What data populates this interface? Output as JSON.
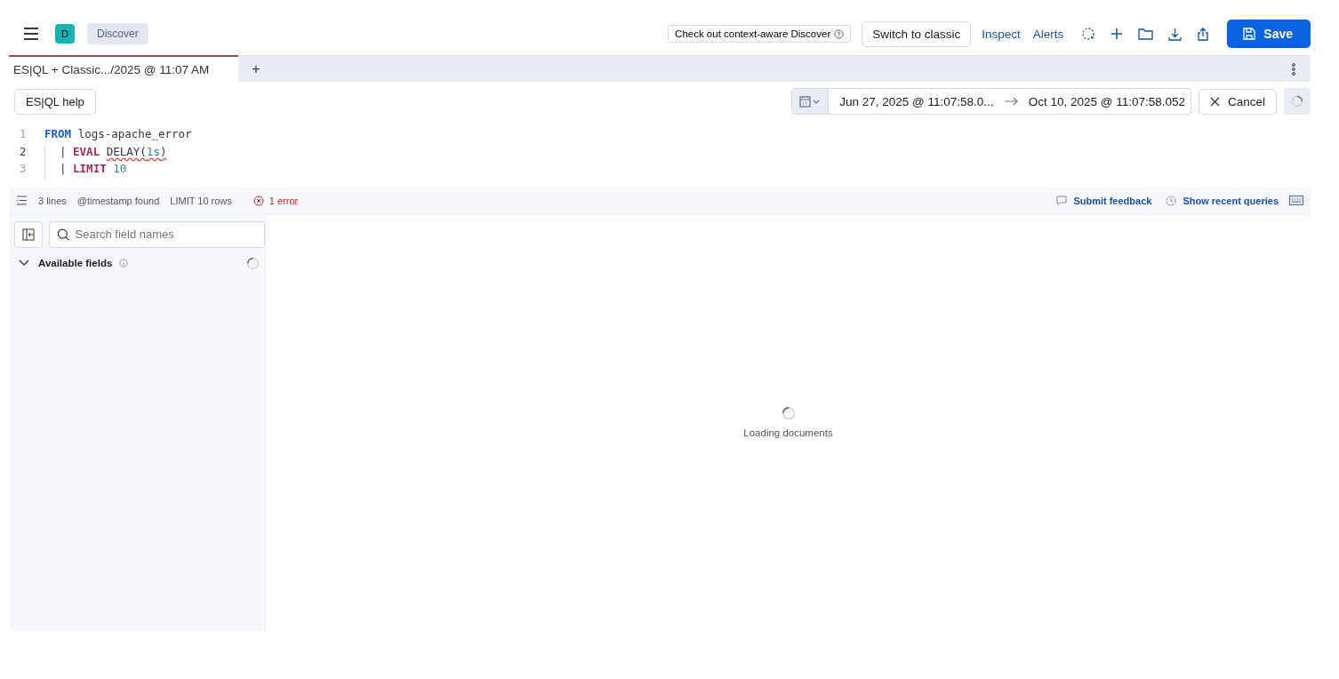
{
  "header": {
    "avatar": "D",
    "breadcrumb": "Discover",
    "actions": [
      {
        "kind": "promo",
        "label": "Check out context-aware Discover"
      },
      {
        "kind": "button",
        "label": "Switch to classic"
      },
      {
        "kind": "link",
        "label": "Inspect"
      },
      {
        "kind": "link",
        "label": "Alerts"
      },
      {
        "kind": "primary",
        "label": "Save"
      }
    ]
  },
  "tabs": [
    {
      "label": "ES|QL + Classic.../2025 @ 11:07 AM",
      "selected": true
    }
  ],
  "new_tab": "+",
  "query_bar": {
    "help_button": "ES|QL help",
    "date_start": "Jun 27, 2025 @ 11:07:58.0...",
    "date_end": "Oct 10, 2025 @ 11:07:58.052",
    "cancel": "Cancel"
  },
  "editor": {
    "lines": [
      {
        "number": "1",
        "current": false,
        "tokens": [
          {
            "text": "FROM ",
            "kind": "command",
            "error": false
          },
          {
            "text": "logs-apache_error",
            "kind": "plain",
            "error": false
          }
        ]
      },
      {
        "number": "2",
        "current": true,
        "tokens": [
          {
            "text": "| ",
            "kind": "pipe",
            "error": false
          },
          {
            "text": "EVAL ",
            "kind": "keyword",
            "error": false
          },
          {
            "text": "DELAY(",
            "kind": "plain",
            "error": true
          },
          {
            "text": "1s",
            "kind": "number",
            "error": true
          },
          {
            "text": ")",
            "kind": "plain",
            "error": true
          }
        ]
      },
      {
        "number": "3",
        "current": false,
        "tokens": [
          {
            "text": "| ",
            "kind": "pipe",
            "error": false
          },
          {
            "text": "LIMIT ",
            "kind": "keyword",
            "error": false
          },
          {
            "text": "10",
            "kind": "number",
            "error": false
          }
        ]
      }
    ]
  },
  "editor_footer": {
    "items": [
      "3 lines",
      "@timestamp found",
      "LIMIT 10 rows"
    ],
    "errors": "1 error",
    "feedback": "Submit feedback",
    "recent": "Show recent queries"
  },
  "sidebar": {
    "search": {
      "placeholder": "Search field names"
    },
    "section": {
      "label": "Available fields",
      "expanded": true
    }
  },
  "main": {
    "status": "Loading documents"
  }
}
